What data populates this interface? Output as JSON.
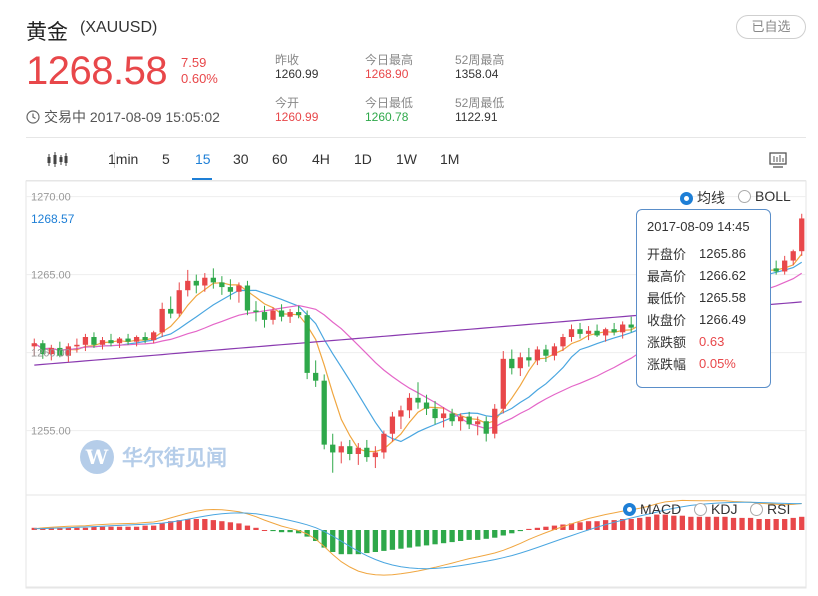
{
  "header": {
    "name": "黄金",
    "code": "(XAUUSD)",
    "watch_label": "已自选",
    "price": "1268.58",
    "change": "7.59",
    "change_pct": "0.60%",
    "status": "交易中 2017-08-09 15:05:02"
  },
  "stats": [
    {
      "label": "昨收",
      "value": "1260.99",
      "tone": "neutral"
    },
    {
      "label": "今日最高",
      "value": "1268.90",
      "tone": "red"
    },
    {
      "label": "52周最高",
      "value": "1358.04",
      "tone": "neutral"
    },
    {
      "label": "今开",
      "value": "1260.99",
      "tone": "red"
    },
    {
      "label": "今日最低",
      "value": "1260.78",
      "tone": "green"
    },
    {
      "label": "52周最低",
      "value": "1122.91",
      "tone": "neutral"
    }
  ],
  "toolbar": {
    "periods": [
      "1min",
      "5",
      "15",
      "30",
      "60",
      "4H",
      "1D",
      "1W",
      "1M"
    ],
    "active": "15"
  },
  "main_chart": {
    "indicator_options": [
      "均线",
      "BOLL"
    ],
    "selected": "均线",
    "y_ticks": [
      "1270.00",
      "1265.00",
      "1260.00",
      "1255.00"
    ],
    "current_price_label": "1268.57"
  },
  "tooltip": {
    "time": "2017-08-09 14:45",
    "rows": [
      {
        "k": "开盘价",
        "v": "1265.86",
        "tone": "neutral"
      },
      {
        "k": "最高价",
        "v": "1266.62",
        "tone": "neutral"
      },
      {
        "k": "最低价",
        "v": "1265.58",
        "tone": "neutral"
      },
      {
        "k": "收盘价",
        "v": "1266.49",
        "tone": "neutral"
      },
      {
        "k": "涨跌额",
        "v": "0.63",
        "tone": "red"
      },
      {
        "k": "涨跌幅",
        "v": "0.05%",
        "tone": "red"
      }
    ]
  },
  "sub_chart": {
    "indicator_options": [
      "MACD",
      "KDJ",
      "RSI"
    ],
    "selected": "MACD"
  },
  "watermark": "华尔街见闻",
  "colors": {
    "up": "#e8474a",
    "down": "#2ea84a",
    "accent": "#1e7fd6",
    "ma5": "#f0a640",
    "ma10": "#4aa6e0",
    "ma20": "#e466c8",
    "ma60": "#8a3ab0"
  },
  "chart_data": {
    "type": "candlestick",
    "interval": "15",
    "y_range": [
      1251.0,
      1271.0
    ],
    "candles": [
      [
        1260.4,
        1260.9,
        1259.8,
        1260.6
      ],
      [
        1260.6,
        1260.8,
        1259.6,
        1259.9
      ],
      [
        1259.9,
        1260.5,
        1259.5,
        1260.3
      ],
      [
        1260.3,
        1260.7,
        1259.7,
        1259.8
      ],
      [
        1259.8,
        1260.6,
        1259.4,
        1260.4
      ],
      [
        1260.4,
        1260.9,
        1260.0,
        1260.5
      ],
      [
        1260.5,
        1261.2,
        1260.1,
        1261.0
      ],
      [
        1261.0,
        1261.3,
        1260.3,
        1260.5
      ],
      [
        1260.5,
        1261.0,
        1260.2,
        1260.8
      ],
      [
        1260.8,
        1261.2,
        1260.4,
        1260.6
      ],
      [
        1260.6,
        1261.0,
        1260.3,
        1260.9
      ],
      [
        1260.9,
        1261.2,
        1260.5,
        1260.7
      ],
      [
        1260.7,
        1261.1,
        1260.4,
        1261.0
      ],
      [
        1261.0,
        1261.3,
        1260.6,
        1260.8
      ],
      [
        1260.8,
        1261.4,
        1260.6,
        1261.3
      ],
      [
        1261.3,
        1263.2,
        1261.0,
        1262.8
      ],
      [
        1262.8,
        1263.6,
        1262.2,
        1262.5
      ],
      [
        1262.5,
        1264.5,
        1262.3,
        1264.0
      ],
      [
        1264.0,
        1265.3,
        1263.6,
        1264.6
      ],
      [
        1264.6,
        1265.0,
        1263.8,
        1264.3
      ],
      [
        1264.3,
        1265.1,
        1263.9,
        1264.8
      ],
      [
        1264.8,
        1265.4,
        1264.1,
        1264.5
      ],
      [
        1264.5,
        1264.9,
        1263.7,
        1264.2
      ],
      [
        1264.2,
        1264.7,
        1263.4,
        1263.9
      ],
      [
        1263.9,
        1264.5,
        1263.2,
        1264.3
      ],
      [
        1264.3,
        1264.6,
        1262.4,
        1262.7
      ],
      [
        1262.7,
        1263.3,
        1262.0,
        1262.6
      ],
      [
        1262.6,
        1263.0,
        1261.6,
        1262.1
      ],
      [
        1262.1,
        1262.9,
        1261.8,
        1262.7
      ],
      [
        1262.7,
        1263.1,
        1262.0,
        1262.3
      ],
      [
        1262.3,
        1262.8,
        1261.9,
        1262.6
      ],
      [
        1262.6,
        1263.0,
        1262.2,
        1262.4
      ],
      [
        1262.4,
        1262.7,
        1258.3,
        1258.7
      ],
      [
        1258.7,
        1259.5,
        1257.8,
        1258.2
      ],
      [
        1258.2,
        1258.6,
        1253.8,
        1254.1
      ],
      [
        1254.1,
        1254.8,
        1252.3,
        1253.6
      ],
      [
        1253.6,
        1254.3,
        1252.9,
        1254.0
      ],
      [
        1254.0,
        1254.4,
        1253.1,
        1253.5
      ],
      [
        1253.5,
        1254.2,
        1252.8,
        1253.9
      ],
      [
        1253.9,
        1254.4,
        1253.0,
        1253.3
      ],
      [
        1253.3,
        1254.0,
        1252.6,
        1253.6
      ],
      [
        1253.6,
        1255.0,
        1253.2,
        1254.8
      ],
      [
        1254.8,
        1256.2,
        1254.3,
        1255.9
      ],
      [
        1255.9,
        1256.6,
        1255.1,
        1256.3
      ],
      [
        1256.3,
        1257.4,
        1255.8,
        1257.1
      ],
      [
        1257.1,
        1258.1,
        1256.4,
        1256.8
      ],
      [
        1256.8,
        1257.3,
        1256.0,
        1256.4
      ],
      [
        1256.4,
        1256.9,
        1255.4,
        1255.8
      ],
      [
        1255.8,
        1256.5,
        1255.2,
        1256.1
      ],
      [
        1256.1,
        1256.4,
        1255.3,
        1255.6
      ],
      [
        1255.6,
        1256.1,
        1255.0,
        1255.9
      ],
      [
        1255.9,
        1256.2,
        1255.1,
        1255.4
      ],
      [
        1255.4,
        1255.9,
        1254.7,
        1255.6
      ],
      [
        1255.6,
        1255.9,
        1254.3,
        1254.8
      ],
      [
        1254.8,
        1256.7,
        1254.5,
        1256.4
      ],
      [
        1256.4,
        1260.1,
        1256.1,
        1259.6
      ],
      [
        1259.6,
        1260.2,
        1258.6,
        1259.0
      ],
      [
        1259.0,
        1260.0,
        1258.5,
        1259.7
      ],
      [
        1259.7,
        1260.3,
        1259.1,
        1259.5
      ],
      [
        1259.5,
        1260.4,
        1259.2,
        1260.2
      ],
      [
        1260.2,
        1260.5,
        1259.4,
        1259.8
      ],
      [
        1259.8,
        1260.6,
        1259.5,
        1260.4
      ],
      [
        1260.4,
        1261.2,
        1260.1,
        1261.0
      ],
      [
        1261.0,
        1261.8,
        1260.7,
        1261.5
      ],
      [
        1261.5,
        1261.9,
        1260.9,
        1261.2
      ],
      [
        1261.2,
        1261.7,
        1260.8,
        1261.4
      ],
      [
        1261.4,
        1261.8,
        1261.0,
        1261.1
      ],
      [
        1261.1,
        1261.6,
        1260.7,
        1261.5
      ],
      [
        1261.5,
        1261.9,
        1261.1,
        1261.3
      ],
      [
        1261.3,
        1262.0,
        1260.9,
        1261.8
      ],
      [
        1261.8,
        1262.3,
        1261.3,
        1261.6
      ],
      [
        1261.6,
        1262.9,
        1261.4,
        1262.6
      ],
      [
        1262.6,
        1264.0,
        1262.3,
        1263.7
      ],
      [
        1263.7,
        1266.8,
        1263.4,
        1266.2
      ],
      [
        1266.2,
        1266.8,
        1263.5,
        1263.9
      ],
      [
        1263.9,
        1264.6,
        1262.9,
        1264.2
      ],
      [
        1264.2,
        1265.2,
        1263.8,
        1264.9
      ],
      [
        1264.9,
        1265.4,
        1263.4,
        1263.8
      ],
      [
        1263.8,
        1264.8,
        1263.5,
        1264.5
      ],
      [
        1264.5,
        1265.3,
        1264.0,
        1264.9
      ],
      [
        1264.9,
        1265.6,
        1264.5,
        1265.2
      ],
      [
        1265.2,
        1265.8,
        1264.8,
        1265.4
      ],
      [
        1265.4,
        1265.9,
        1264.9,
        1265.0
      ],
      [
        1265.0,
        1265.7,
        1264.6,
        1265.3
      ],
      [
        1265.3,
        1265.8,
        1264.8,
        1265.5
      ],
      [
        1265.5,
        1265.9,
        1264.9,
        1265.1
      ],
      [
        1265.1,
        1265.6,
        1264.7,
        1265.4
      ],
      [
        1265.4,
        1265.9,
        1265.0,
        1265.2
      ],
      [
        1265.2,
        1266.2,
        1265.0,
        1265.9
      ],
      [
        1265.9,
        1266.6,
        1265.6,
        1266.5
      ],
      [
        1266.5,
        1268.9,
        1266.2,
        1268.6
      ]
    ],
    "macd_bars": [
      0.02,
      0.02,
      0.02,
      0.02,
      0.02,
      0.02,
      0.02,
      0.03,
      0.03,
      0.03,
      0.03,
      0.03,
      0.03,
      0.04,
      0.04,
      0.06,
      0.08,
      0.09,
      0.1,
      0.1,
      0.1,
      0.09,
      0.08,
      0.07,
      0.06,
      0.04,
      0.02,
      0.0,
      -0.01,
      -0.02,
      -0.02,
      -0.03,
      -0.06,
      -0.1,
      -0.16,
      -0.2,
      -0.22,
      -0.22,
      -0.22,
      -0.21,
      -0.2,
      -0.19,
      -0.18,
      -0.17,
      -0.16,
      -0.15,
      -0.14,
      -0.13,
      -0.12,
      -0.11,
      -0.1,
      -0.09,
      -0.09,
      -0.08,
      -0.07,
      -0.05,
      -0.03,
      -0.01,
      0.01,
      0.02,
      0.03,
      0.04,
      0.05,
      0.06,
      0.07,
      0.08,
      0.08,
      0.09,
      0.09,
      0.1,
      0.1,
      0.11,
      0.12,
      0.14,
      0.14,
      0.13,
      0.13,
      0.12,
      0.12,
      0.12,
      0.12,
      0.12,
      0.11,
      0.11,
      0.11,
      0.1,
      0.1,
      0.1,
      0.1,
      0.11,
      0.12
    ]
  }
}
